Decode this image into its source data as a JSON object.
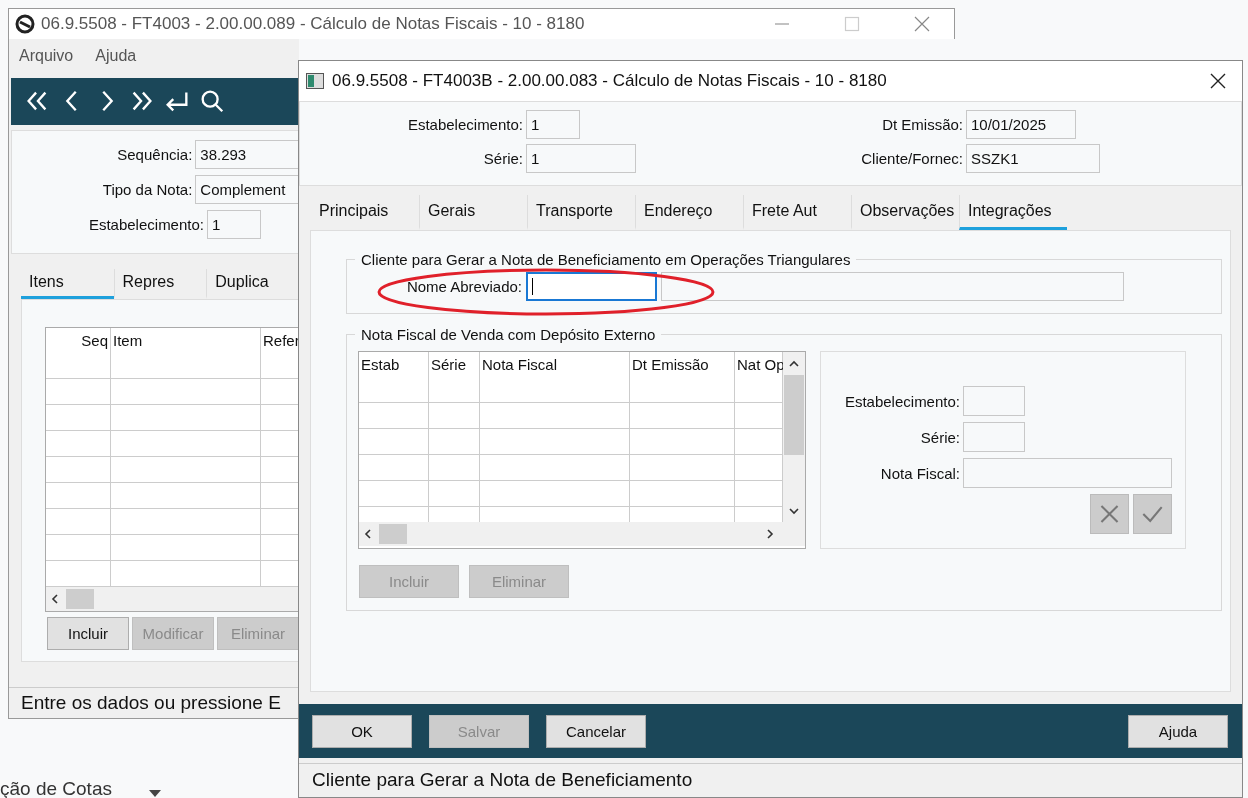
{
  "back_window": {
    "title": "06.9.5508 - FT4003 - 2.00.00.089 - Cálculo de Notas Fiscais - 10 - 8180",
    "menu": [
      "Arquivo",
      "Ajuda"
    ],
    "fields": [
      {
        "label": "Sequência:",
        "value": "38.293",
        "kind": "wide"
      },
      {
        "label": "Tipo da Nota:",
        "value": "Complement",
        "kind": "wide"
      },
      {
        "label": "Estabelecimento:",
        "value": "1",
        "kind": "short"
      }
    ],
    "tabs": [
      {
        "label": "Itens",
        "selected": true
      },
      {
        "label": "Repres",
        "selected": false
      },
      {
        "label": "Duplica",
        "selected": false
      }
    ],
    "grid_columns": [
      "Seq",
      "Item",
      "Refer"
    ],
    "buttons": [
      {
        "label": "Incluir",
        "disabled": false
      },
      {
        "label": "Modificar",
        "disabled": true
      },
      {
        "label": "Eliminar",
        "disabled": true
      }
    ],
    "status_bar": "Entre os dados ou pressione E"
  },
  "dialog": {
    "title": "06.9.5508 - FT4003B - 2.00.00.083 - Cálculo de Notas Fiscais - 10 - 8180",
    "header_left": [
      {
        "label": "Estabelecimento:",
        "value": "1",
        "kind": "short"
      },
      {
        "label": "Série:",
        "value": "1",
        "kind": "medium"
      }
    ],
    "header_right": [
      {
        "label": "Dt Emissão:",
        "value": "10/01/2025",
        "kind": "medium"
      },
      {
        "label": "Cliente/Fornec:",
        "value": "SSZK1",
        "kind": "wide"
      }
    ],
    "tabs": [
      {
        "label": "Principais",
        "selected": false
      },
      {
        "label": "Gerais",
        "selected": false
      },
      {
        "label": "Transporte",
        "selected": false
      },
      {
        "label": "Endereço",
        "selected": false
      },
      {
        "label": "Frete Aut",
        "selected": false
      },
      {
        "label": "Observações",
        "selected": false
      },
      {
        "label": "Integrações",
        "selected": true
      }
    ],
    "triangular_group": {
      "title": "Cliente para Gerar a Nota de Beneficiamento em Operações Triangulares",
      "label": "Nome Abreviado:",
      "focused": true
    },
    "deposit_group": {
      "title": "Nota Fiscal de Venda com Depósito Externo",
      "columns": [
        "Estab",
        "Série",
        "Nota Fiscal",
        "Dt Emissão",
        "Nat Op"
      ],
      "fields": [
        {
          "label": "Estabelecimento:",
          "kind": "short"
        },
        {
          "label": "Série:",
          "kind": "short"
        },
        {
          "label": "Nota Fiscal:",
          "kind": "wide"
        }
      ],
      "actions": [
        {
          "kind": "cancel",
          "disabled": true
        },
        {
          "kind": "confirm",
          "disabled": true
        }
      ],
      "buttons": [
        {
          "label": "Incluir",
          "disabled": true
        },
        {
          "label": "Eliminar",
          "disabled": true
        }
      ]
    },
    "buttons": [
      {
        "label": "OK",
        "disabled": false,
        "kind": "left"
      },
      {
        "label": "Salvar",
        "disabled": true,
        "kind": "left"
      },
      {
        "label": "Cancelar",
        "disabled": false,
        "kind": "left"
      },
      {
        "label": "Ajuda",
        "disabled": false,
        "kind": "right"
      }
    ],
    "status_bar": "Cliente para Gerar a Nota de Beneficiamento"
  },
  "background_text": "ção de Cotas"
}
